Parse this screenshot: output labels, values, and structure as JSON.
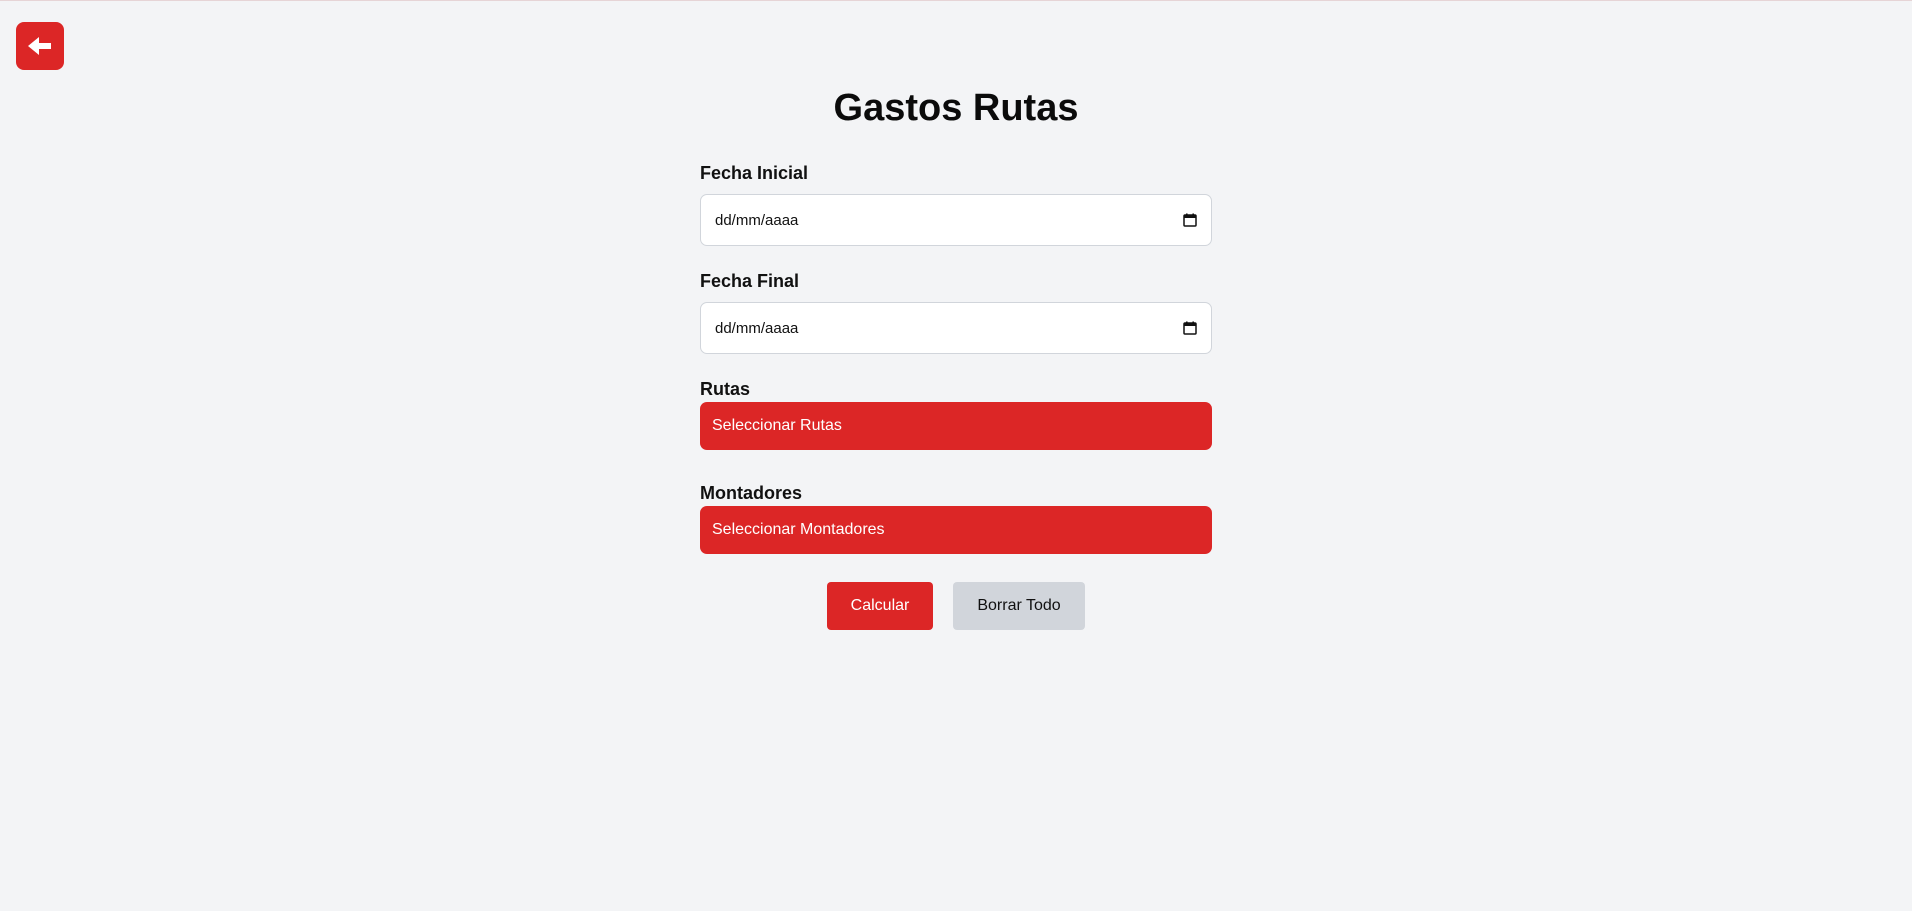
{
  "header": {
    "back_icon": "arrow-left-icon",
    "title": "Gastos Rutas"
  },
  "form": {
    "fecha_inicial": {
      "label": "Fecha Inicial",
      "placeholder": "dd/mm/aaaa",
      "icon": "calendar-icon"
    },
    "fecha_final": {
      "label": "Fecha Final",
      "placeholder": "dd/mm/aaaa",
      "icon": "calendar-icon"
    },
    "rutas": {
      "label": "Rutas",
      "button_label": "Seleccionar Rutas"
    },
    "montadores": {
      "label": "Montadores",
      "button_label": "Seleccionar Montadores"
    }
  },
  "actions": {
    "calcular_label": "Calcular",
    "borrar_label": "Borrar Todo"
  },
  "colors": {
    "accent": "#dc2626",
    "background": "#f3f4f6",
    "secondary_button": "#d1d5db"
  }
}
